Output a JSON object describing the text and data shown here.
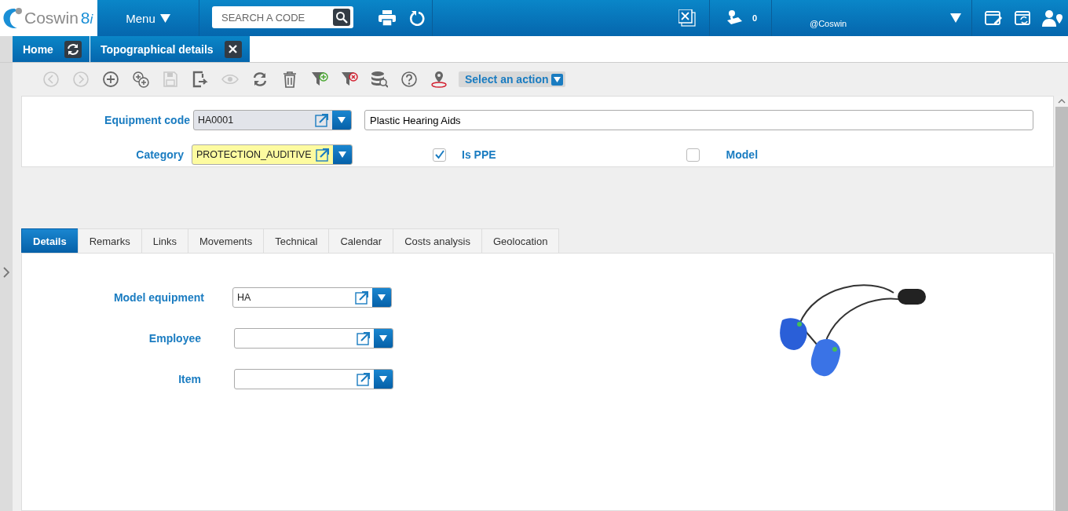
{
  "topbar": {
    "logo": {
      "name": "Coswin",
      "version": "8",
      "suffix": "i"
    },
    "menu": "Menu",
    "search": {
      "placeholder": "SEARCH A CODE"
    },
    "counter": "0",
    "user": "@Coswin"
  },
  "open_tabs": [
    {
      "label": "Home",
      "kind": "refresh"
    },
    {
      "label": "Topographical details",
      "kind": "close"
    }
  ],
  "toolbar": [
    {
      "kind": "back",
      "disabled": true
    },
    {
      "kind": "forward",
      "disabled": true
    },
    {
      "kind": "add",
      "disabled": false
    },
    {
      "kind": "add-multi",
      "disabled": false
    },
    {
      "kind": "save",
      "disabled": true
    },
    {
      "kind": "export",
      "disabled": false
    },
    {
      "kind": "view",
      "disabled": true
    },
    {
      "kind": "refresh",
      "disabled": false
    },
    {
      "kind": "delete",
      "disabled": false
    },
    {
      "kind": "filter-add",
      "disabled": false
    },
    {
      "kind": "filter-remove",
      "disabled": false
    },
    {
      "kind": "database",
      "disabled": false
    },
    {
      "kind": "help",
      "disabled": false
    },
    {
      "kind": "location",
      "disabled": false
    }
  ],
  "action_select": "Select an action",
  "header": {
    "equipment_code": {
      "label": "Equipment code",
      "value": "HA0001",
      "kind": "readonly"
    },
    "description": {
      "value": "Plastic Hearing Aids"
    },
    "category": {
      "label": "Category",
      "value": "PROTECTION_AUDITIVE",
      "kind": "required"
    },
    "checkboxes": [
      {
        "label": "Is PPE",
        "checked": true
      },
      {
        "label": "Model",
        "checked": false
      }
    ]
  },
  "tabs": [
    {
      "label": "Details",
      "selected": true
    },
    {
      "label": "Remarks",
      "selected": false
    },
    {
      "label": "Links",
      "selected": false
    },
    {
      "label": "Movements",
      "selected": false
    },
    {
      "label": "Technical",
      "selected": false
    },
    {
      "label": "Calendar",
      "selected": false
    },
    {
      "label": "Costs analysis",
      "selected": false
    },
    {
      "label": "Geolocation",
      "selected": false
    }
  ],
  "details": [
    {
      "label": "Model equipment",
      "value": "HA"
    },
    {
      "label": "Employee"
    },
    {
      "label": "Item"
    }
  ]
}
